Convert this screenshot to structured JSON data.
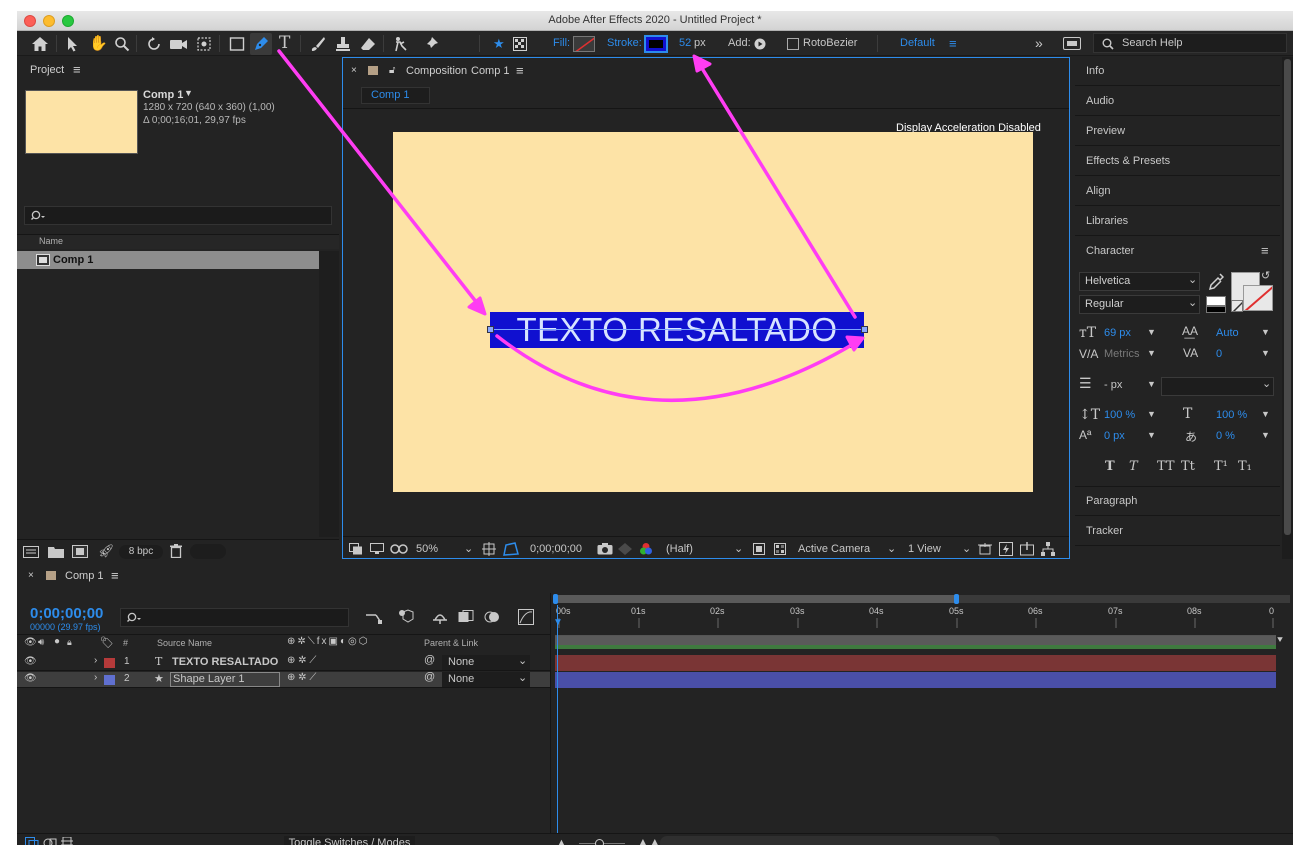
{
  "window": {
    "title": "Adobe After Effects 2020 - Untitled Project *"
  },
  "toolbar": {
    "fill_label": "Fill:",
    "stroke_label": "Stroke:",
    "stroke_width": "52",
    "stroke_unit": "px",
    "add_label": "Add:",
    "rotobezier_label": "RotoBezier",
    "workspace": "Default",
    "search_placeholder": "Search Help"
  },
  "project": {
    "title": "Project",
    "comp_name": "Comp 1",
    "comp_info_1": "1280 x 720  (640 x 360) (1,00)",
    "comp_info_2": "Δ 0;00;16;01, 29,97 fps",
    "column_name": "Name",
    "item_name": "Comp 1",
    "bpc": "8 bpc"
  },
  "composition": {
    "tab_title_prefix": "Composition",
    "tab_title_comp": "Comp 1",
    "subtab": "Comp 1",
    "notice": "Display Acceleration Disabled",
    "text_content": "TEXTO RESALTADO",
    "zoom": "50%",
    "timecode": "0;00;00;00",
    "resolution": "(Half)",
    "camera": "Active Camera",
    "views": "1 View"
  },
  "right_panels": {
    "items": [
      "Info",
      "Audio",
      "Preview",
      "Effects & Presets",
      "Align",
      "Libraries"
    ],
    "character_title": "Character",
    "font_family": "Helvetica",
    "font_style": "Regular",
    "font_size": "69 px",
    "leading": "Auto",
    "kerning": "Metrics",
    "tracking": "0",
    "stroke_px": "- px",
    "vert_scale": "100 %",
    "horiz_scale": "100 %",
    "baseline": "0 px",
    "tsume": "0 %",
    "format_buttons": [
      "T",
      "T",
      "TT",
      "Tt",
      "T¹",
      "T₁"
    ],
    "paragraph": "Paragraph",
    "tracker": "Tracker"
  },
  "timeline": {
    "tab_title": "Comp 1",
    "timecode": "0;00;00;00",
    "frame_info": "00000 (29.97 fps)",
    "col_num": "#",
    "col_source": "Source Name",
    "col_parent": "Parent & Link",
    "ruler": [
      "00s",
      "01s",
      "02s",
      "03s",
      "04s",
      "05s",
      "06s",
      "07s",
      "08s",
      "0"
    ],
    "layers": [
      {
        "num": "1",
        "type_icon": "T",
        "name": "TEXTO RESALTADO",
        "parent": "None",
        "color": "#b53a3a",
        "bar_color": "#7a3535"
      },
      {
        "num": "2",
        "type_icon": "★",
        "name": "Shape Layer 1",
        "parent": "None",
        "color": "#6070d0",
        "bar_color": "#4a4fa8"
      }
    ],
    "toggle_label": "Toggle Switches / Modes"
  },
  "colors": {
    "accent": "#2d8ceb",
    "comp_bg": "#fde3a6",
    "highlight_box": "#1010d0",
    "annotation": "#ff3df3"
  }
}
